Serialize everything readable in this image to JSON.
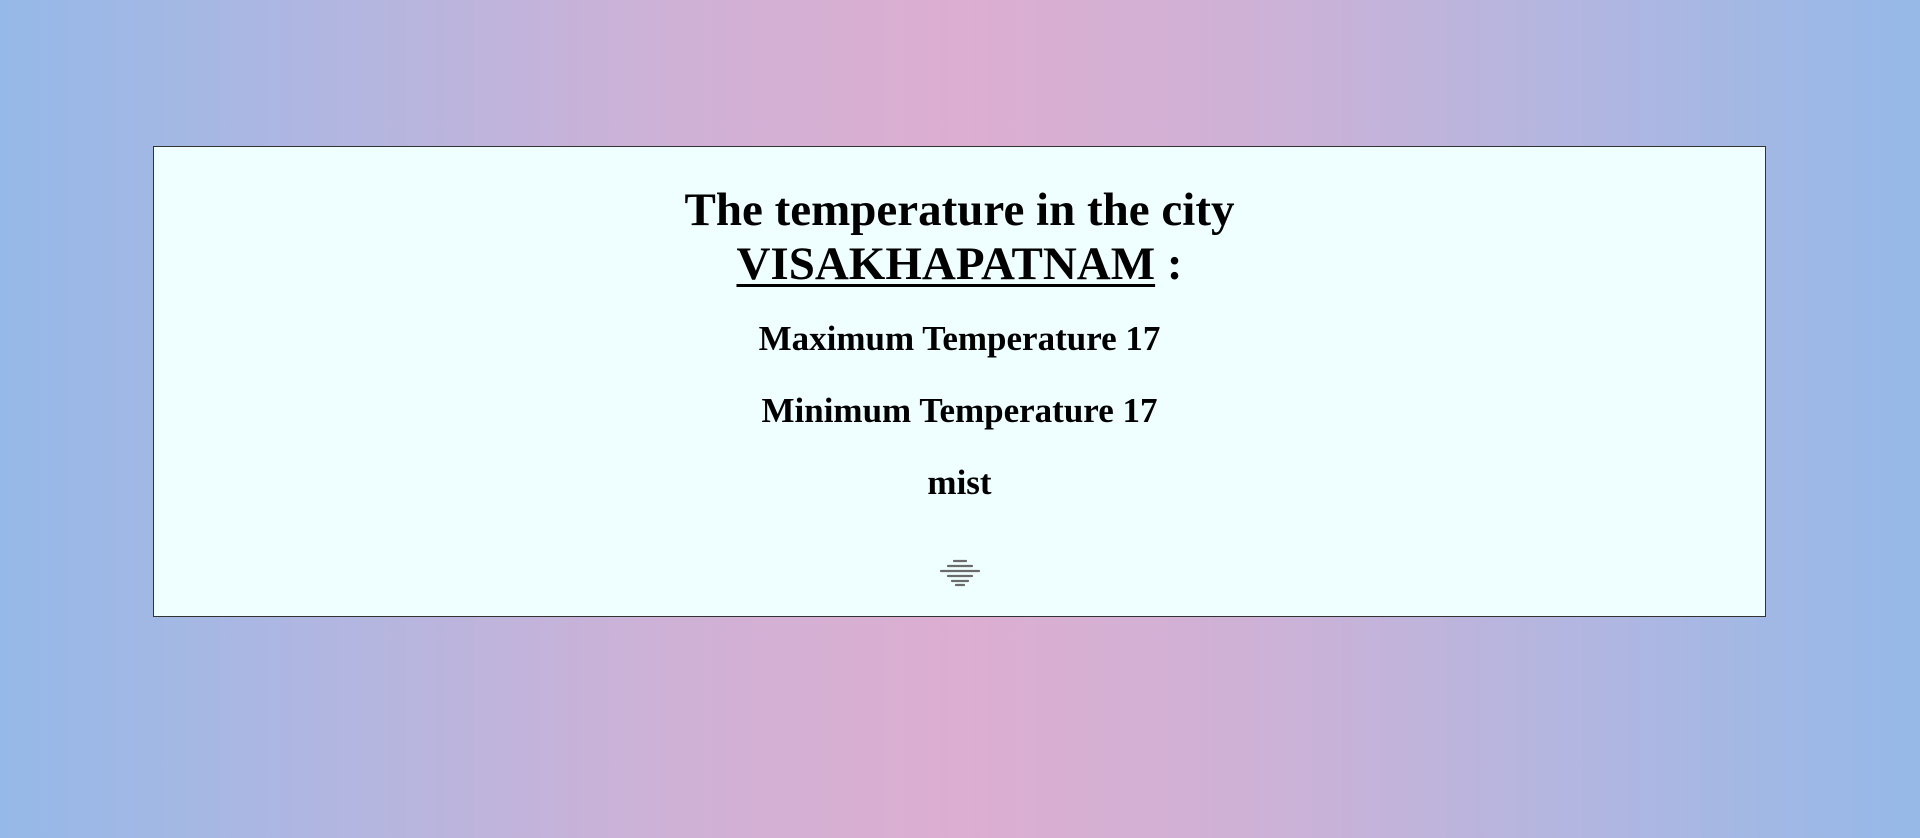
{
  "weather": {
    "title_prefix": "The temperature in the city",
    "city": "VISAKHAPATNAM",
    "title_suffix": ":",
    "max_label": "Maximum Temperature",
    "max_value": "17",
    "min_label": "Minimum Temperature",
    "min_value": "17",
    "description": "mist",
    "icon": "mist-icon"
  },
  "colors": {
    "card_background": "#efffff",
    "page_gradient_edge": "#95b9e8",
    "page_gradient_center": "#dcaed1"
  }
}
